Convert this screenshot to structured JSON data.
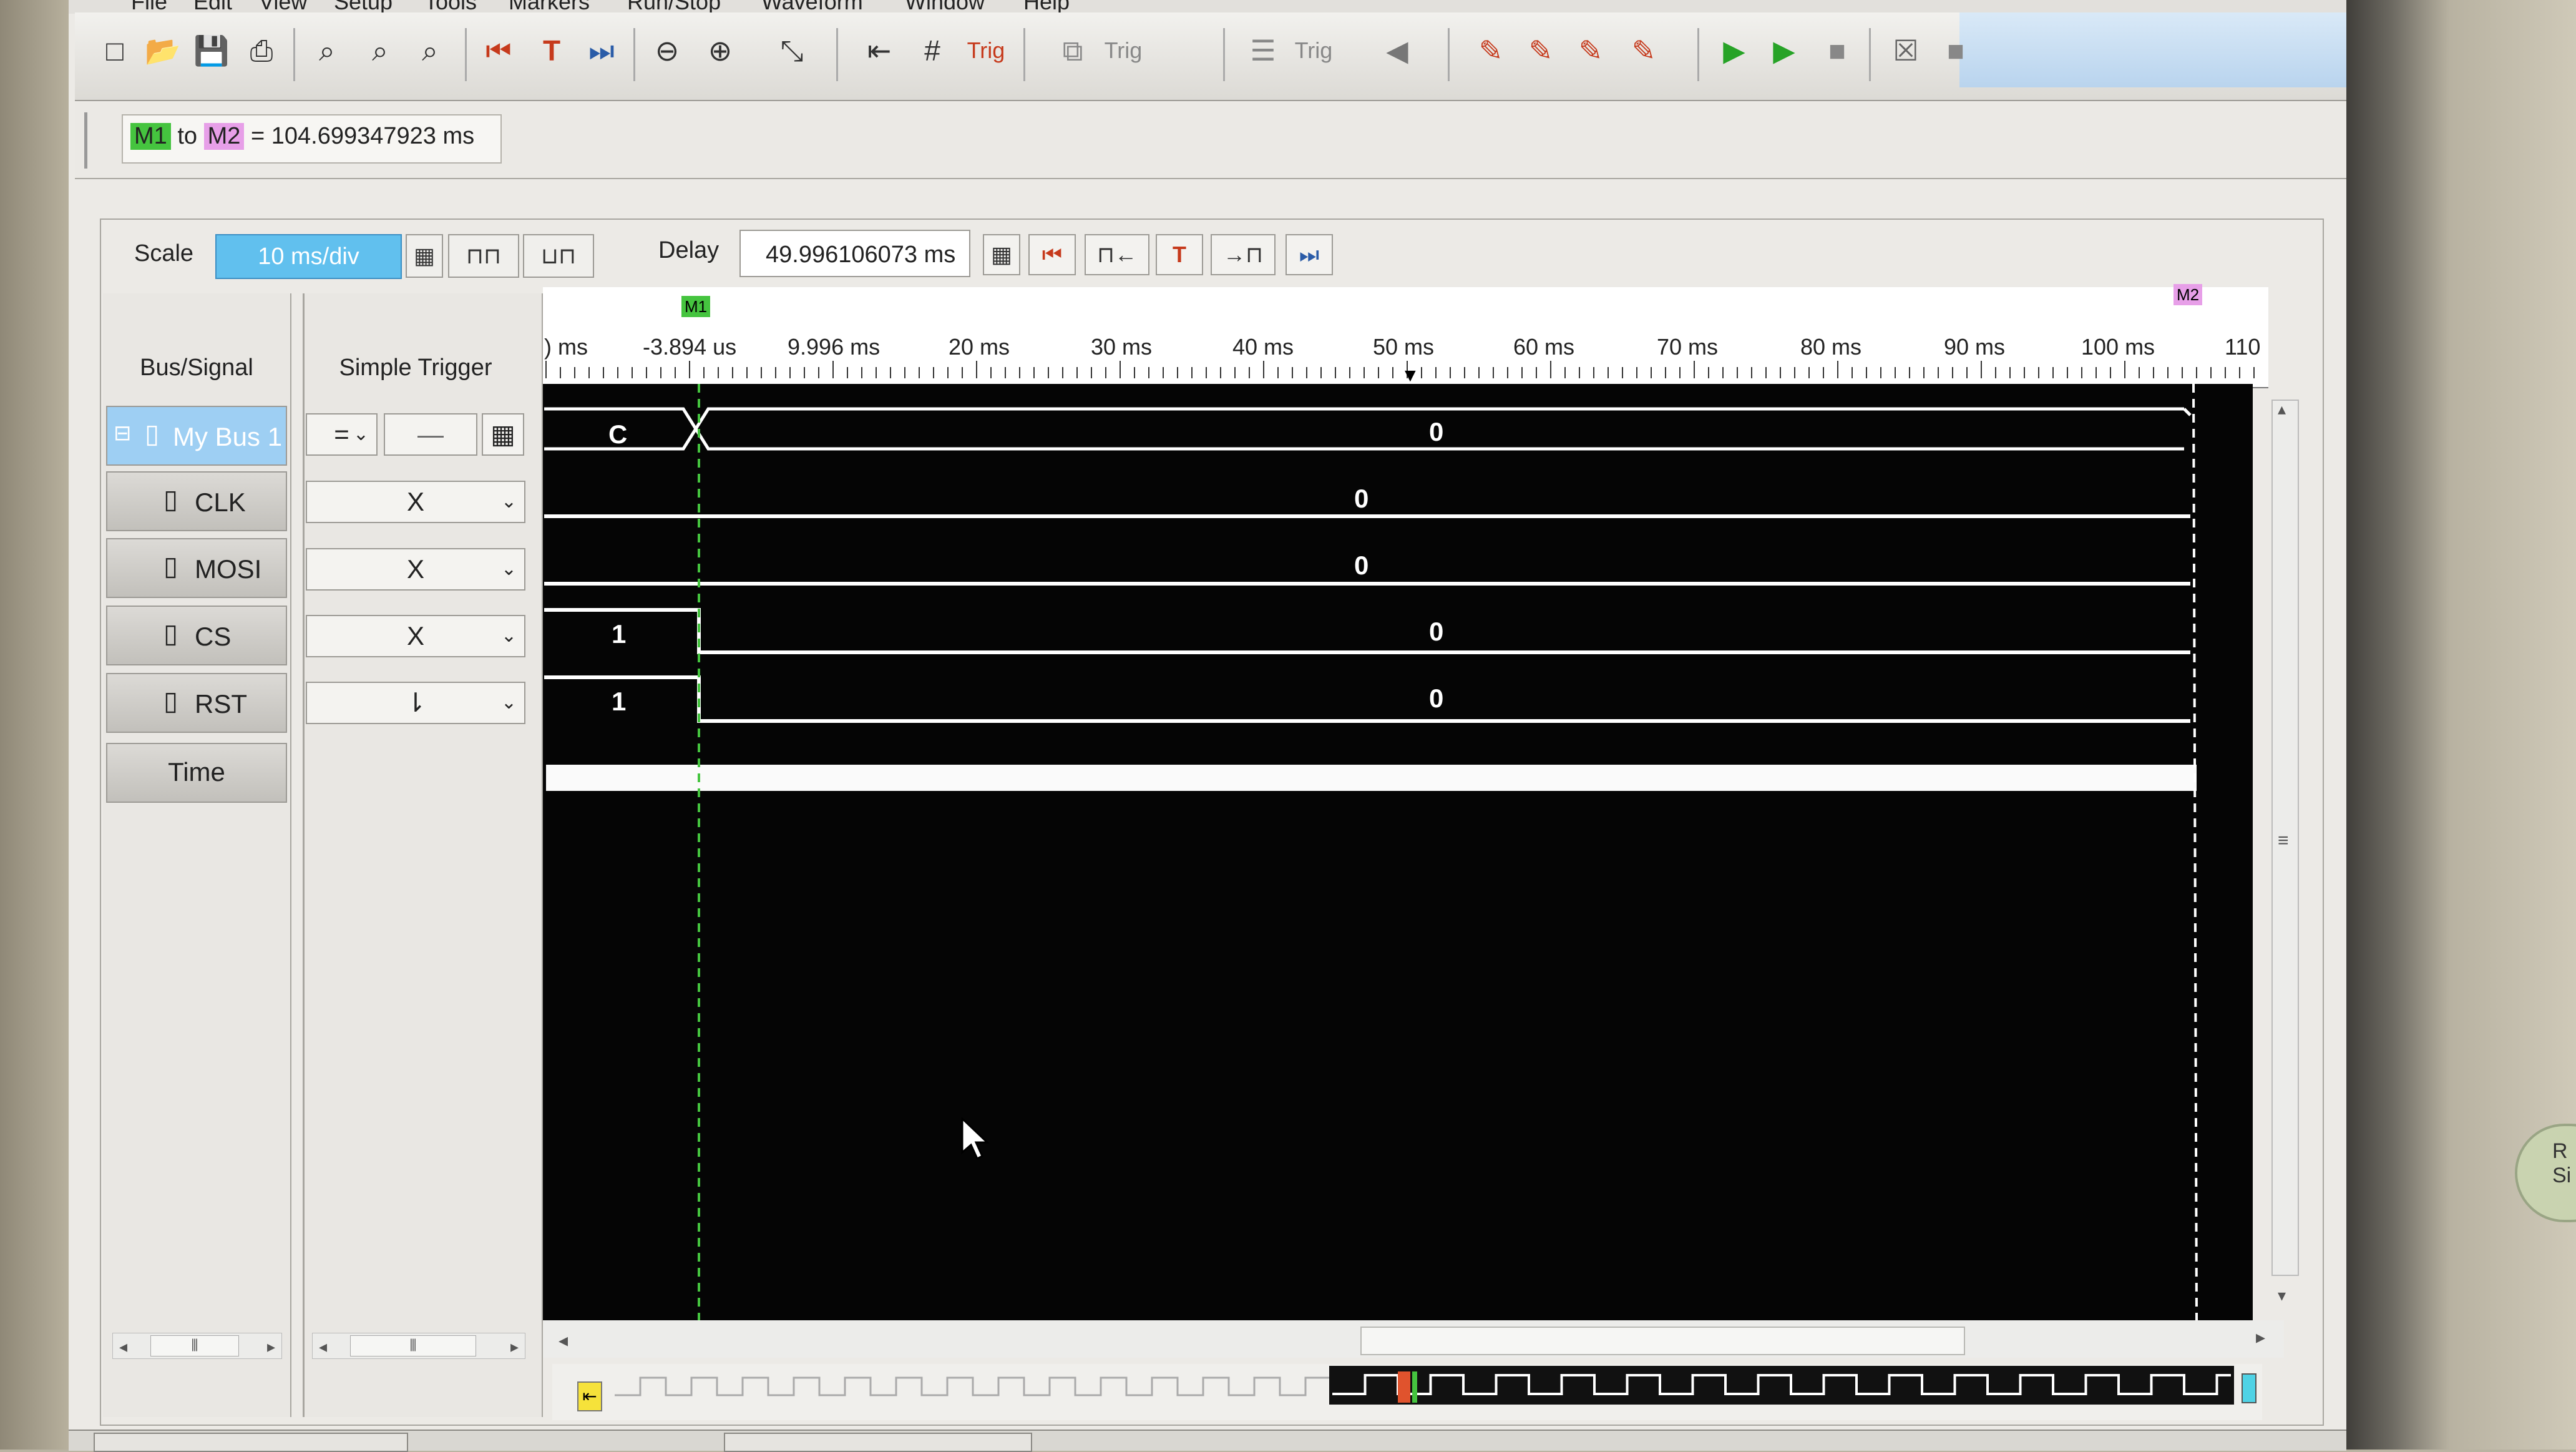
{
  "menu": [
    "File",
    "Edit",
    "View",
    "Setup",
    "Tools",
    "Markers",
    "Run/Stop",
    "Waveform",
    "Window",
    "Help"
  ],
  "toolbar": {
    "trig_labels": [
      "Trig",
      "Trig",
      "Trig"
    ]
  },
  "marker_readout": {
    "m1": "M1",
    "to": "to",
    "m2": "M2",
    "value": "= 104.699347923 ms"
  },
  "scale": {
    "label": "Scale",
    "value": "10 ms/div"
  },
  "delay": {
    "label": "Delay",
    "value": "49.996106073 ms"
  },
  "columns": {
    "bus_signal": "Bus/Signal",
    "simple_trigger": "Simple Trigger"
  },
  "signals": [
    {
      "name": "My Bus 1",
      "trigger": "=",
      "value_left": "C",
      "value_right": "0"
    },
    {
      "name": "CLK",
      "trigger": "X",
      "value_right": "0"
    },
    {
      "name": "MOSI",
      "trigger": "X",
      "value_right": "0"
    },
    {
      "name": "CS",
      "trigger": "X",
      "value_left": "1",
      "value_right": "0"
    },
    {
      "name": "RST",
      "trigger": "⇂",
      "value_left": "1",
      "value_right": "0"
    }
  ],
  "bus_trigger_value": "—",
  "time_row": "Time",
  "ruler": {
    "ticks": [
      ") ms",
      "-3.894 us",
      "9.996 ms",
      "20 ms",
      "30 ms",
      "40 ms",
      "50 ms",
      "60 ms",
      "70 ms",
      "80 ms",
      "90 ms",
      "100 ms",
      "110"
    ],
    "marker1": "M1",
    "marker2": "M2"
  },
  "knob_label": "R\nSi",
  "colors": {
    "accent_blue": "#61c0ee",
    "m1_green": "#45c43f",
    "m2_pink": "#e79fe8",
    "waveform_bg": "#050505"
  }
}
